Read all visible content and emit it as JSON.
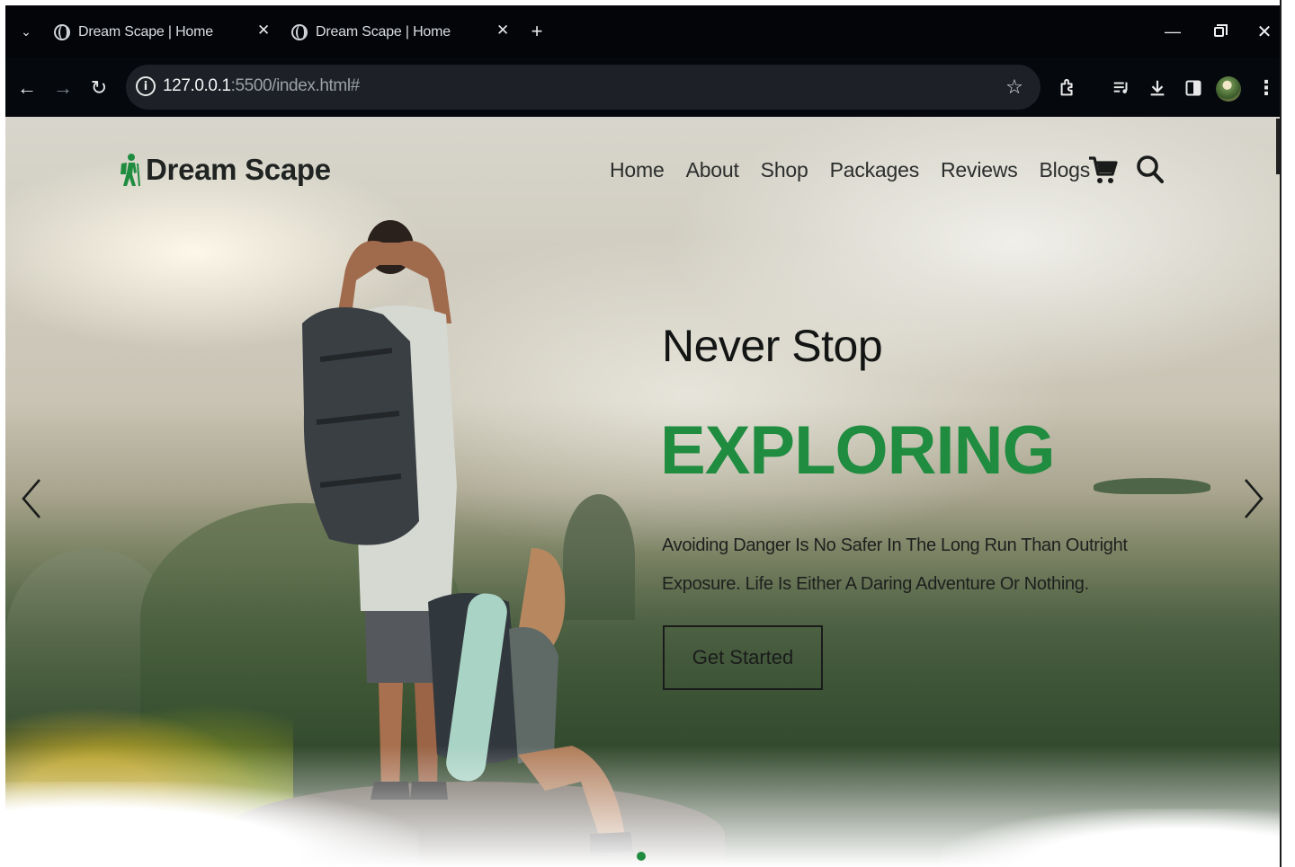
{
  "browser": {
    "tabs": [
      {
        "title": "Dream Scape | Home"
      },
      {
        "title": "Dream Scape | Home"
      }
    ],
    "url_host": "127.0.0.1",
    "url_rest": ":5500/index.html#"
  },
  "site": {
    "logo_text": "Dream Scape",
    "nav": [
      "Home",
      "About",
      "Shop",
      "Packages",
      "Reviews",
      "Blogs"
    ],
    "accent_color": "#1f8c3f"
  },
  "hero": {
    "headline": "Never Stop",
    "accent": "EXPLORING",
    "description": "Avoiding Danger Is No Safer In The Long Run Than Outright Exposure. Life Is Either A Daring Adventure Or Nothing.",
    "cta_label": "Get Started"
  }
}
